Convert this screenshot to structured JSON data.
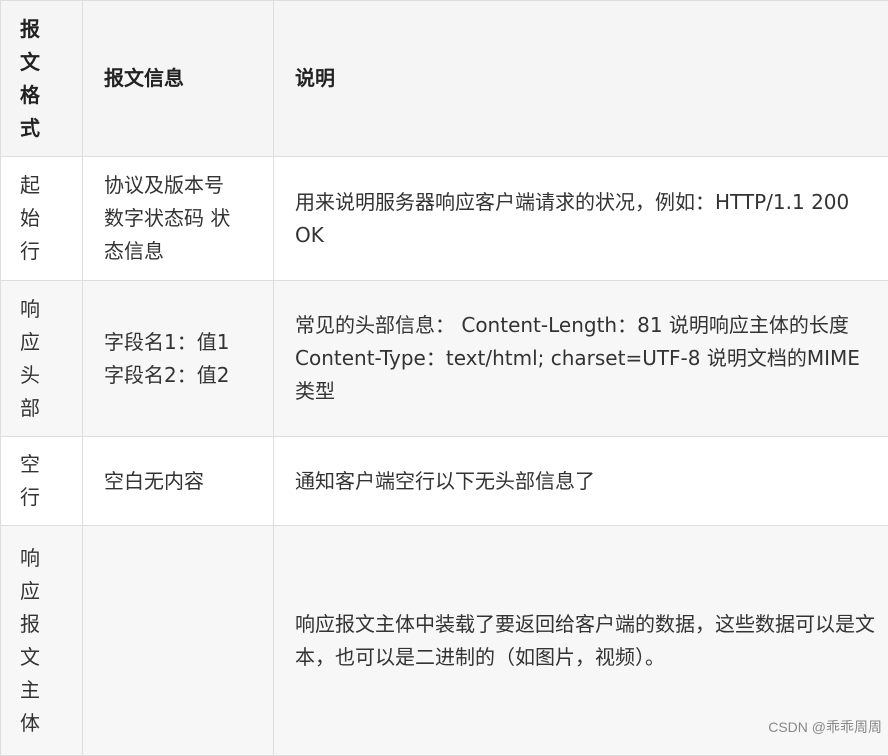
{
  "table": {
    "header": {
      "col1": "报文格式",
      "col2": "报文信息",
      "col3": "说明"
    },
    "rows": [
      {
        "format": "起始行",
        "info_lines": [
          "协议及版本号",
          "数字状态码 状",
          "态信息"
        ],
        "desc": "用来说明服务器响应客户端请求的状况，例如：HTTP/1.1 200 OK"
      },
      {
        "format": "响应头部",
        "info_lines": [
          "字段名1：值1",
          "字段名2：值2"
        ],
        "desc": "常见的头部信息：  Content-Length：81 说明响应主体的长度  Content-Type：text/html; charset=UTF-8 说明文档的MIME类型"
      },
      {
        "format": "空行",
        "info_lines": [
          "空白无内容"
        ],
        "desc": "通知客户端空行以下无头部信息了"
      },
      {
        "format": "响应报文主体",
        "info_lines": [],
        "desc": "响应报文主体中装载了要返回给客户端的数据，这些数据可以是文本，也可以是二进制的（如图片，视频）。"
      }
    ]
  },
  "watermark": "CSDN @乖乖周周"
}
